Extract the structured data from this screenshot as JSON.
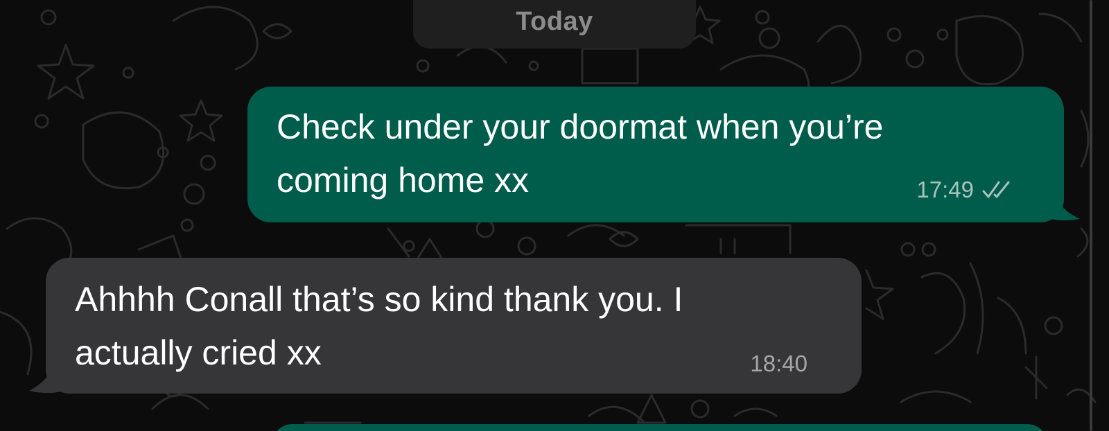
{
  "chat": {
    "date_label": "Today",
    "messages": [
      {
        "direction": "outgoing",
        "text": "Check under your doormat when you’re\ncoming home xx",
        "time": "17:49",
        "status_icon": "double-check-icon"
      },
      {
        "direction": "incoming",
        "text": "Ahhhh Conall that’s so kind thank you. I\nactually cried xx",
        "time": "18:40"
      }
    ]
  },
  "colors": {
    "outgoing_bubble": "#005c4b",
    "incoming_bubble": "#363638",
    "background": "#0c0c0c",
    "date_pill": "#1f1f1f"
  }
}
